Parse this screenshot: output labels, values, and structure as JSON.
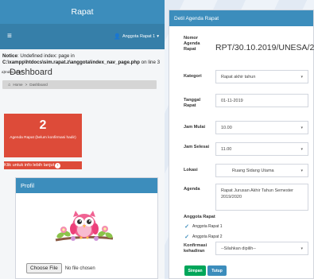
{
  "left": {
    "title": "Rapat",
    "user": "Anggota Rapat 1",
    "notice": {
      "label": "Notice",
      "text": ": Undefined index: page in",
      "path": "C:\\xampp\\htdocs\\sim.rapat.z\\anggota\\index_nav_page.php",
      "suffix": " on line 3"
    },
    "dashboard_title": "Dashboard",
    "dashboard_overlap": "a)Index.php?",
    "breadcrumb": {
      "home": "Home",
      "sep": ">",
      "current": "Dashboard"
    },
    "agenda_box": {
      "count": "2",
      "label": "Agenda Rapat (belum konfirmasi hadir)",
      "link": "Klik untuk info lebih lanjut"
    },
    "profil": {
      "title": "Profil",
      "file_button": "Choose File",
      "file_status": "No file chosen"
    }
  },
  "right": {
    "title": "Detil Agenda Rapat",
    "fields": {
      "nomor_label": "Nomor Agenda Rapat",
      "nomor_value": "RPT/30.10.2019/UNESA/2",
      "kategori_label": "Kategori",
      "kategori_value": "Rapat akhir tahun",
      "tanggal_label": "Tanggal Rapat",
      "tanggal_value": "01-11-2019",
      "jam_mulai_label": "Jam Mulai",
      "jam_mulai_value": "10.00",
      "jam_selesai_label": "Jam Selesai",
      "jam_selesai_value": "11.00",
      "lokasi_label": "Lokasi",
      "lokasi_value": "Ruang Sidang Utama",
      "agenda_label": "Agenda",
      "agenda_value": "Rapat Jurusan Akhir Tahun Semester 2019/2020"
    },
    "anggota_label": "Anggota Rapat",
    "anggota": [
      "Anggota Rapat 1",
      "Anggota Rapat 2"
    ],
    "konfirmasi_label": "Konfirmasi kehadiran",
    "konfirmasi_placeholder": "--Silahkan dipilih--",
    "buttons": {
      "save": "Simpan",
      "close": "Tutup"
    }
  },
  "colors": {
    "primary": "#3c8dbc",
    "nav": "#367fa9",
    "danger": "#dd4b39",
    "success": "#00a65a"
  }
}
